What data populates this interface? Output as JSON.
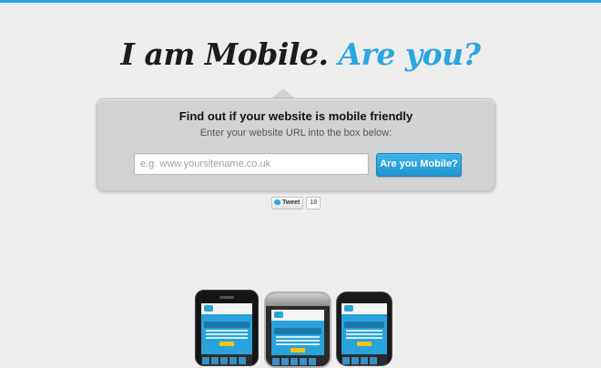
{
  "accent_color": "#2aa6e0",
  "headline": {
    "main": "I am Mobile.",
    "accent": "Are you?"
  },
  "panel": {
    "title": "Find out if your website is mobile friendly",
    "subtitle": "Enter your website URL into the box below:",
    "url_input": {
      "placeholder": "e.g. www.yoursitename.co.uk",
      "value": ""
    },
    "submit_label": "Are you Mobile?"
  },
  "social": {
    "tweet_label": "Tweet",
    "tweet_count": "18"
  },
  "devices": [
    {
      "name": "iPhone",
      "icon": "iphone-icon"
    },
    {
      "name": "BlackBerry",
      "icon": "blackberry-icon"
    },
    {
      "name": "Samsung",
      "icon": "samsung-icon"
    }
  ]
}
